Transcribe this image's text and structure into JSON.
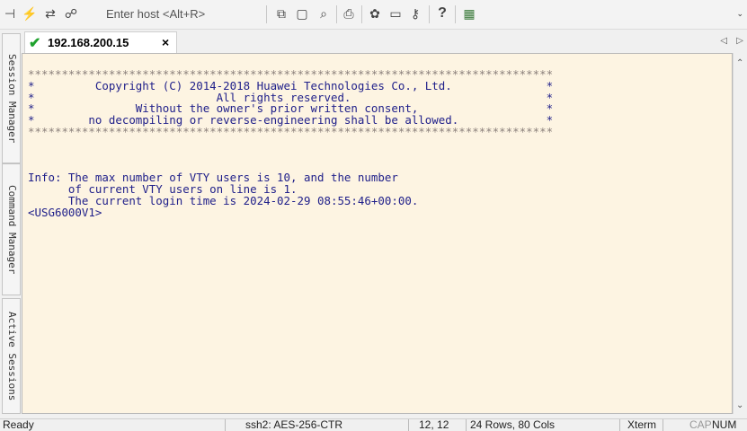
{
  "toolbar": {
    "host_placeholder": "Enter host <Alt+R>",
    "icons": [
      "connect-icon",
      "quick-connect-icon",
      "reconnect-icon",
      "link-icon",
      "copy-icon",
      "paste-icon",
      "find-icon",
      "print-icon",
      "settings-icon",
      "options-icon",
      "key-icon",
      "help-icon",
      "sftp-icon"
    ]
  },
  "tab": {
    "title": "192.168.200.15",
    "close": "×",
    "check": "✔"
  },
  "side_panel": {
    "session_manager": "Session Manager",
    "command_manager": "Command Manager",
    "active_sessions": "Active Sessions"
  },
  "terminal": {
    "stars": "******************************************************************************",
    "banner": [
      "*         Copyright (C) 2014-2018 Huawei Technologies Co., Ltd.              *",
      "*                           All rights reserved.                             *",
      "*               Without the owner's prior written consent,                   *",
      "*        no decompiling or reverse-engineering shall be allowed.             *"
    ],
    "info": [
      "Info: The max number of VTY users is 10, and the number",
      "      of current VTY users on line is 1.",
      "      The current login time is 2024-02-29 08:55:46+00:00.",
      "<USG6000V1>"
    ]
  },
  "status_bar": {
    "ready": "Ready",
    "cipher": "ssh2: AES-256-CTR",
    "position": "12, 12",
    "size": "24 Rows, 80 Cols",
    "term": "Xterm",
    "cap": "CAP",
    "num": "NUM"
  }
}
